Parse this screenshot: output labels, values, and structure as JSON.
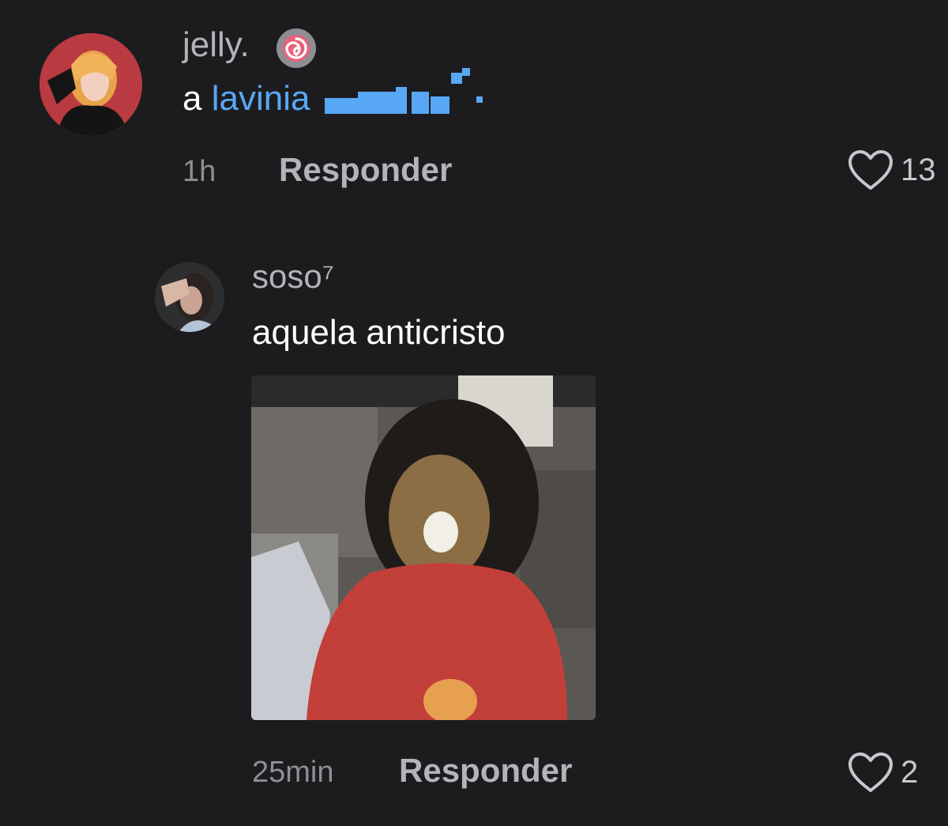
{
  "comments": [
    {
      "username": "jelly.",
      "badge_icon": "spiral-badge-icon",
      "text_prefix": "a",
      "mention": "lavinia",
      "time": "1h",
      "reply_label": "Responder",
      "like_count": "13",
      "avatar_icon": "profile-photo"
    },
    {
      "username": "soso⁷",
      "text": "aquela anticristo",
      "time": "25min",
      "reply_label": "Responder",
      "like_count": "2",
      "avatar_icon": "profile-photo",
      "media_icon": "gif-image"
    }
  ],
  "colors": {
    "background": "#1c1c1e",
    "mention": "#58a7f5",
    "secondary_text": "#8e8e93"
  }
}
